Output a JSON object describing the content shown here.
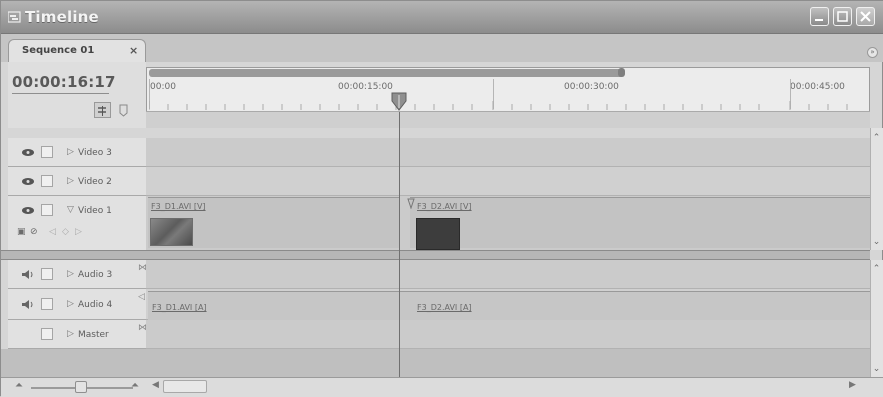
{
  "window": {
    "title": "Timeline"
  },
  "tab": {
    "label": "Sequence 01",
    "close": "×"
  },
  "panel_menu_icon": "panel-menu-icon",
  "header": {
    "timecode": "00:00:16:17"
  },
  "ruler": {
    "ticks": [
      "00:00",
      "00:00:15:00",
      "00:00:30:00",
      "00:00:45:00"
    ]
  },
  "video_tracks": [
    {
      "name": "Video 3"
    },
    {
      "name": "Video 2"
    },
    {
      "name": "Video 1",
      "expanded": true
    }
  ],
  "audio_tracks": [
    {
      "name": "Audio 3"
    },
    {
      "name": "Audio 4"
    },
    {
      "name": "Master"
    }
  ],
  "clips": {
    "video1_a": "F3_D1.AVI [V]",
    "video1_b": "F3_D2.AVI [V]",
    "audio4_a": "F3_D1.AVI [A]",
    "audio4_b": "F3_D2.AVI [A]"
  },
  "colors": {
    "background": "#d6d6d6",
    "titlebar": "#9e9e9e",
    "track": "#cbcbcb",
    "clip_dark": "#3d3d3d"
  },
  "icons": {
    "eye": "eye-icon",
    "speaker": "speaker-icon",
    "expand": "triangle-right-icon",
    "collapse": "triangle-down-icon",
    "minimize": "minimize-icon",
    "maximize": "maximize-icon",
    "close": "close-icon",
    "snap": "snap-icon",
    "marker": "marker-icon",
    "zoom_out": "zoom-out-icon",
    "zoom_in": "zoom-in-icon"
  }
}
